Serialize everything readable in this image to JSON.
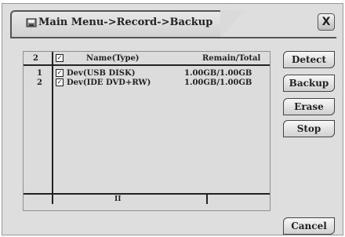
{
  "window": {
    "title": "Main Menu->Record->Backup",
    "close_label": "X"
  },
  "table": {
    "headers": {
      "count": "2",
      "name": "Name(Type)",
      "remain": "Remain/Total"
    },
    "rows": [
      {
        "index": "1",
        "checked": true,
        "name": "Dev(USB DISK)",
        "capacity": "1.00GB/1.00GB"
      },
      {
        "index": "2",
        "checked": true,
        "name": "Dev(IDE DVD+RW)",
        "capacity": "1.00GB/1.00GB"
      }
    ],
    "page_indicator": "II"
  },
  "buttons": {
    "detect": "Detect",
    "backup": "Backup",
    "erase": "Erase",
    "stop": "Stop",
    "cancel": "Cancel"
  },
  "icons": {
    "title": "disk-icon",
    "close": "close-icon",
    "checkbox": "checkmark-icon"
  }
}
